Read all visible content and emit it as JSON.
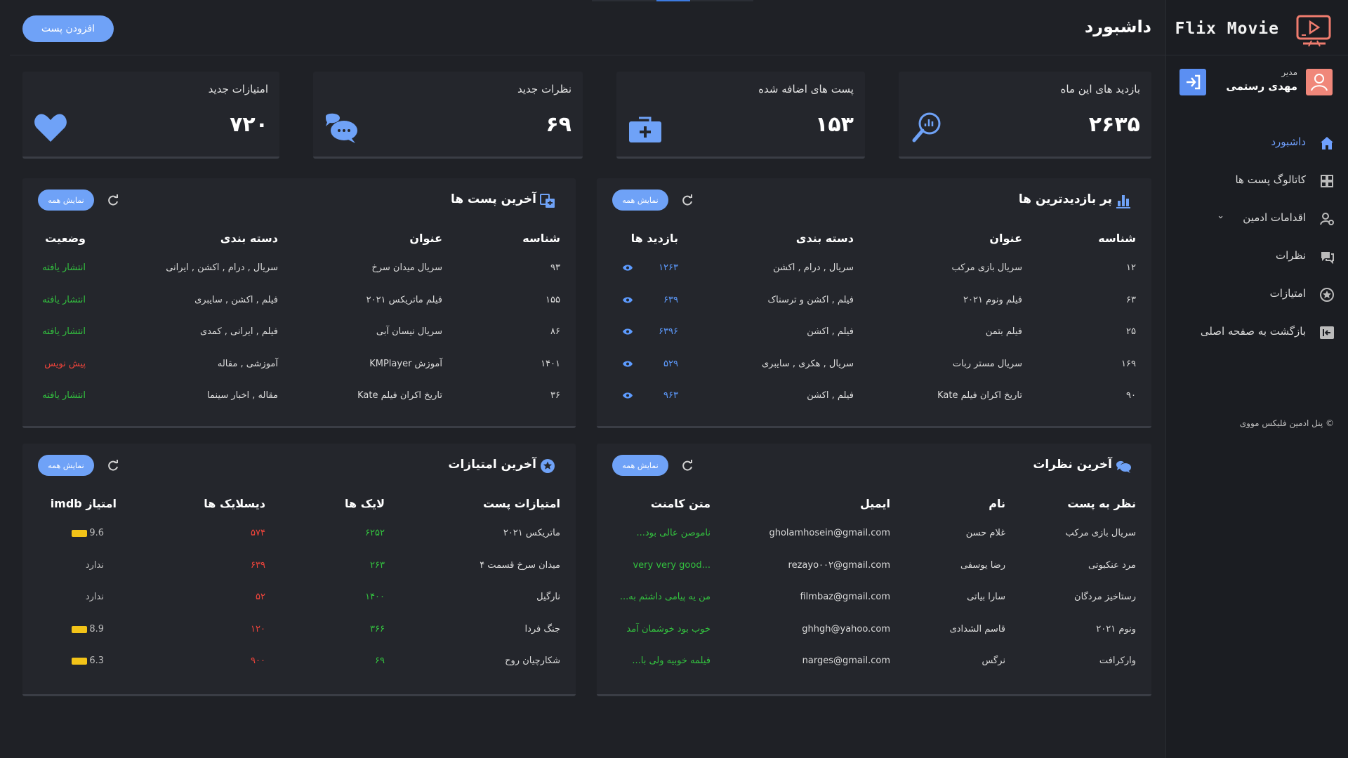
{
  "app": {
    "name": "Flix Movie",
    "page_title": "داشبورد",
    "add_post_label": "افزودن پست"
  },
  "user": {
    "role": "مدیر",
    "name": "مهدی رستمی"
  },
  "nav": [
    {
      "label": "داشبورد",
      "icon": "home-icon",
      "active": true
    },
    {
      "label": "کاتالوگ پست ها",
      "icon": "grid-icon"
    },
    {
      "label": "اقدامات ادمین",
      "icon": "admin-icon",
      "has_submenu": true
    },
    {
      "label": "نظرات",
      "icon": "comments-icon"
    },
    {
      "label": "امتیازات",
      "icon": "star-icon"
    },
    {
      "label": "بازگشت به صفحه اصلی",
      "icon": "back-icon"
    }
  ],
  "copyright": "© پنل ادمین فلیکس مووی",
  "stats": [
    {
      "title": "بازدید های این ماه",
      "value": "۲۶۳۵",
      "icon": "search-chart-icon"
    },
    {
      "title": "پست های اضافه شده",
      "value": "۱۵۳",
      "icon": "medical-case-icon"
    },
    {
      "title": "نظرات جدید",
      "value": "۶۹",
      "icon": "chat-bubbles-icon"
    },
    {
      "title": "امتیازات جدید",
      "value": "۷۲۰",
      "icon": "heart-icon"
    }
  ],
  "colors": {
    "accent": "#6fa2f7",
    "green": "#33c13f",
    "red": "#f0443b",
    "blue": "#5d9bff",
    "card": "#24262c",
    "bg": "#1f2126"
  },
  "show_all_label": "نمایش همه",
  "most_viewed": {
    "title": "پر بازدیدترین ها",
    "headers": [
      "شناسه",
      "عنوان",
      "دسته بندی",
      "بازدید ها"
    ],
    "rows": [
      [
        "۱۲",
        "سریال بازی مرکب",
        "سریال , درام , اکشن",
        "۱۲۶۳"
      ],
      [
        "۶۳",
        "فیلم ونوم ۲۰۲۱",
        "فیلم , اکشن و ترسناک",
        "۶۳۹"
      ],
      [
        "۲۵",
        "فیلم بتمن",
        "فیلم , اکشن",
        "۶۳۹۶"
      ],
      [
        "۱۶۹",
        "سریال مستر ربات",
        "سریال , هکری , سایبری",
        "۵۲۹"
      ],
      [
        "۹۰",
        "تاریخ اکران فیلم Kate",
        "فیلم , اکشن",
        "۹۶۳"
      ]
    ]
  },
  "latest_posts": {
    "title": "آخرین پست ها",
    "headers": [
      "شناسه",
      "عنوان",
      "دسته بندی",
      "وضعیت"
    ],
    "rows": [
      [
        "۹۳",
        "سریال میدان سرخ",
        "سریال , درام , اکشن , ایرانی",
        "انتشار یافته"
      ],
      [
        "۱۵۵",
        "فیلم ماتریکس ۲۰۲۱",
        "فیلم , اکشن , سایبری",
        "انتشار یافته"
      ],
      [
        "۸۶",
        "سریال نیسان آبی",
        "فیلم , ایرانی , کمدی",
        "انتشار یافته"
      ],
      [
        "۱۴۰۱",
        "آموزش KMPlayer",
        "آموزشی , مقاله",
        "پیش نویس"
      ],
      [
        "۳۶",
        "تاریخ اکران فیلم Kate",
        "مقاله , اخبار سینما",
        "انتشار یافته"
      ]
    ]
  },
  "latest_comments": {
    "title": "آخرین نظرات",
    "headers": [
      "نظر به پست",
      "نام",
      "ایمیل",
      "متن کامنت"
    ],
    "rows": [
      [
        "سریال بازی مرکب",
        "غلام حسن",
        "gholamhosein@gmail.com",
        "ناموصن عالی بود..."
      ],
      [
        "مرد عنکبوتی",
        "رضا یوسفی",
        "rezayo۰۰۲@gmail.com",
        "...very very good"
      ],
      [
        "رستاخیز مردگان",
        "سارا بیاتی",
        "filmbaz@gmail.com",
        "من یه پیامی داشتم به..."
      ],
      [
        "ونوم ۲۰۲۱",
        "قاسم الشدادی",
        "ghhgh@yahoo.com",
        "خوب بود خوشمان آمد"
      ],
      [
        "وارکرافت",
        "نرگس",
        "narges@gmail.com",
        "فیلمه خوبیه ولی با..."
      ]
    ]
  },
  "latest_ratings": {
    "title": "آخرین امتیازات",
    "headers": [
      "امتیازات پست",
      "لایک ها",
      "دیسلایک ها",
      "امتیاز imdb"
    ],
    "rows": [
      [
        "ماتریکس ۲۰۲۱",
        "۶۲۵۲",
        "۵۷۴",
        "9.6",
        true
      ],
      [
        "میدان سرخ قسمت ۴",
        "۲۶۳",
        "۶۳۹",
        "ندارد",
        false
      ],
      [
        "نارگیل",
        "۱۴۰۰",
        "۵۲",
        "ندارد",
        false
      ],
      [
        "جنگ فردا",
        "۳۶۶",
        "۱۲۰",
        "8.9",
        true
      ],
      [
        "شکارچیان روح",
        "۶۹",
        "۹۰۰",
        "6.3",
        true
      ]
    ]
  }
}
